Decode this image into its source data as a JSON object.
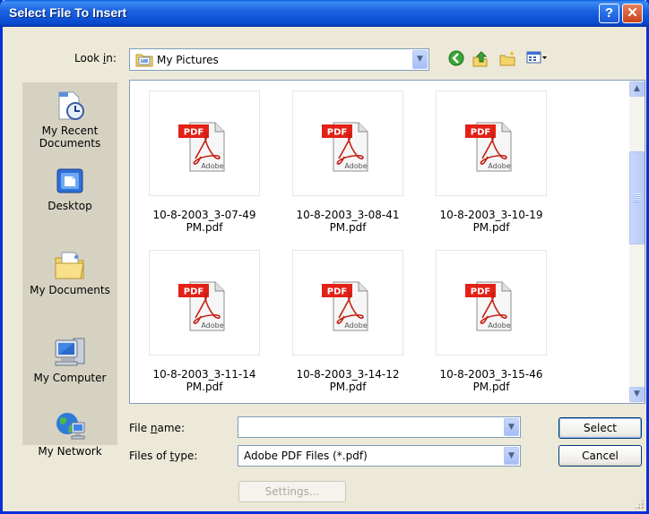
{
  "window": {
    "title": "Select File To Insert",
    "help_glyph": "?",
    "close_glyph": "✕"
  },
  "look_in": {
    "label_pre": "Look ",
    "label_u": "i",
    "label_post": "n:",
    "value": "My Pictures"
  },
  "toolbar": {
    "icons": [
      "back-icon",
      "up-folder-icon",
      "new-folder-icon",
      "views-menu-icon"
    ]
  },
  "places": [
    {
      "line1": "My Recent",
      "line2": "Documents",
      "icon": "recent-documents-icon"
    },
    {
      "line1": "Desktop",
      "line2": "",
      "icon": "desktop-icon"
    },
    {
      "line1": "My Documents",
      "line2": "",
      "icon": "my-documents-icon"
    },
    {
      "line1": "My Computer",
      "line2": "",
      "icon": "my-computer-icon"
    },
    {
      "line1": "My Network",
      "line2": "",
      "icon": "my-network-icon"
    }
  ],
  "files": [
    {
      "line1": "10-8-2003_3-07-49",
      "line2": "PM.pdf"
    },
    {
      "line1": "10-8-2003_3-08-41",
      "line2": "PM.pdf"
    },
    {
      "line1": "10-8-2003_3-10-19",
      "line2": "PM.pdf"
    },
    {
      "line1": "10-8-2003_3-11-14",
      "line2": "PM.pdf"
    },
    {
      "line1": "10-8-2003_3-14-12",
      "line2": "PM.pdf"
    },
    {
      "line1": "10-8-2003_3-15-46",
      "line2": "PM.pdf"
    }
  ],
  "pdf_icon": {
    "badge": "PDF",
    "brand": "Adobe",
    "badge_color": "#E32117"
  },
  "file_name": {
    "label_pre": "File ",
    "label_u": "n",
    "label_post": "ame:",
    "value": ""
  },
  "file_type": {
    "label_pre": "Files of ",
    "label_u": "t",
    "label_post": "ype:",
    "value": "Adobe PDF Files (*.pdf)"
  },
  "buttons": {
    "select": "Select",
    "cancel": "Cancel",
    "settings": "Settings..."
  },
  "colors": {
    "titlebar": "#0A5FDE",
    "dialog_bg": "#ECE9D8",
    "places_bg": "#D6D2C2"
  }
}
